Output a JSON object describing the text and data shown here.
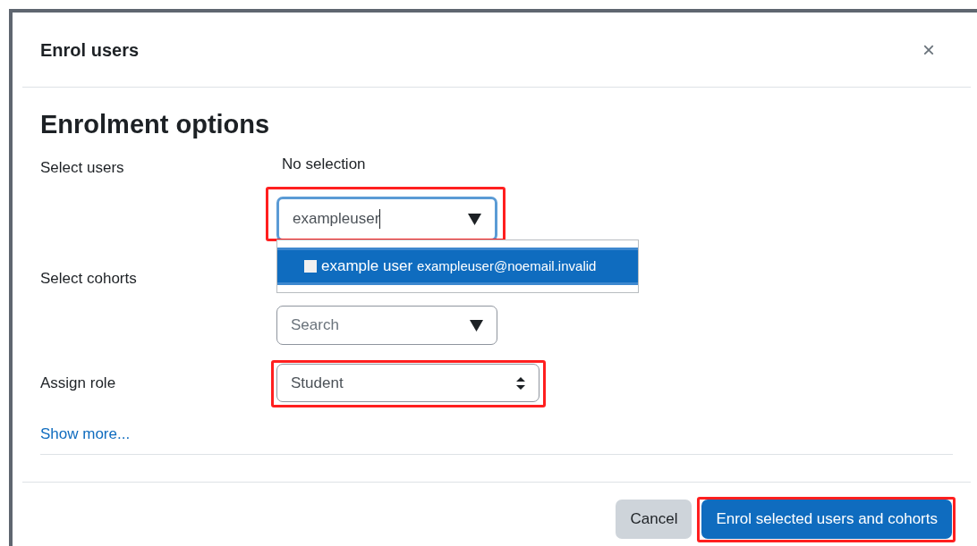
{
  "dialog": {
    "title": "Enrol users",
    "close": "×"
  },
  "heading": "Enrolment options",
  "fields": [
    {
      "kind": "user-picker",
      "label": "Select users",
      "selection": "No selection",
      "value": "exampleuser",
      "focused": true,
      "highlighted": true,
      "suggestions": [
        {
          "name": "example user",
          "email": "exampleuser@noemail.invalid",
          "selected": true
        }
      ]
    },
    {
      "kind": "cohort-picker",
      "label": "Select cohorts",
      "placeholder": "Search",
      "focused": false
    },
    {
      "kind": "select",
      "label": "Assign role",
      "value": "Student",
      "highlighted": true
    }
  ],
  "show_more": "Show more...",
  "buttons": [
    {
      "label": "Cancel",
      "kind": "secondary"
    },
    {
      "label": "Enrol selected users and cohorts",
      "kind": "primary",
      "highlighted": true
    }
  ]
}
